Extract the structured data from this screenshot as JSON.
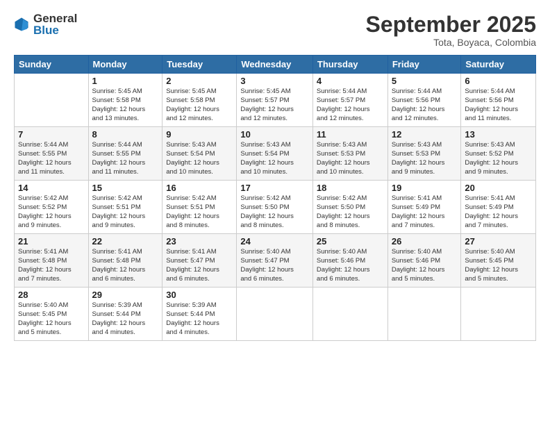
{
  "logo": {
    "general": "General",
    "blue": "Blue"
  },
  "header": {
    "month": "September 2025",
    "location": "Tota, Boyaca, Colombia"
  },
  "days": [
    "Sunday",
    "Monday",
    "Tuesday",
    "Wednesday",
    "Thursday",
    "Friday",
    "Saturday"
  ],
  "weeks": [
    [
      {
        "num": "",
        "text": ""
      },
      {
        "num": "1",
        "text": "Sunrise: 5:45 AM\nSunset: 5:58 PM\nDaylight: 12 hours\nand 13 minutes."
      },
      {
        "num": "2",
        "text": "Sunrise: 5:45 AM\nSunset: 5:58 PM\nDaylight: 12 hours\nand 12 minutes."
      },
      {
        "num": "3",
        "text": "Sunrise: 5:45 AM\nSunset: 5:57 PM\nDaylight: 12 hours\nand 12 minutes."
      },
      {
        "num": "4",
        "text": "Sunrise: 5:44 AM\nSunset: 5:57 PM\nDaylight: 12 hours\nand 12 minutes."
      },
      {
        "num": "5",
        "text": "Sunrise: 5:44 AM\nSunset: 5:56 PM\nDaylight: 12 hours\nand 12 minutes."
      },
      {
        "num": "6",
        "text": "Sunrise: 5:44 AM\nSunset: 5:56 PM\nDaylight: 12 hours\nand 11 minutes."
      }
    ],
    [
      {
        "num": "7",
        "text": "Sunrise: 5:44 AM\nSunset: 5:55 PM\nDaylight: 12 hours\nand 11 minutes."
      },
      {
        "num": "8",
        "text": "Sunrise: 5:44 AM\nSunset: 5:55 PM\nDaylight: 12 hours\nand 11 minutes."
      },
      {
        "num": "9",
        "text": "Sunrise: 5:43 AM\nSunset: 5:54 PM\nDaylight: 12 hours\nand 10 minutes."
      },
      {
        "num": "10",
        "text": "Sunrise: 5:43 AM\nSunset: 5:54 PM\nDaylight: 12 hours\nand 10 minutes."
      },
      {
        "num": "11",
        "text": "Sunrise: 5:43 AM\nSunset: 5:53 PM\nDaylight: 12 hours\nand 10 minutes."
      },
      {
        "num": "12",
        "text": "Sunrise: 5:43 AM\nSunset: 5:53 PM\nDaylight: 12 hours\nand 9 minutes."
      },
      {
        "num": "13",
        "text": "Sunrise: 5:43 AM\nSunset: 5:52 PM\nDaylight: 12 hours\nand 9 minutes."
      }
    ],
    [
      {
        "num": "14",
        "text": "Sunrise: 5:42 AM\nSunset: 5:52 PM\nDaylight: 12 hours\nand 9 minutes."
      },
      {
        "num": "15",
        "text": "Sunrise: 5:42 AM\nSunset: 5:51 PM\nDaylight: 12 hours\nand 9 minutes."
      },
      {
        "num": "16",
        "text": "Sunrise: 5:42 AM\nSunset: 5:51 PM\nDaylight: 12 hours\nand 8 minutes."
      },
      {
        "num": "17",
        "text": "Sunrise: 5:42 AM\nSunset: 5:50 PM\nDaylight: 12 hours\nand 8 minutes."
      },
      {
        "num": "18",
        "text": "Sunrise: 5:42 AM\nSunset: 5:50 PM\nDaylight: 12 hours\nand 8 minutes."
      },
      {
        "num": "19",
        "text": "Sunrise: 5:41 AM\nSunset: 5:49 PM\nDaylight: 12 hours\nand 7 minutes."
      },
      {
        "num": "20",
        "text": "Sunrise: 5:41 AM\nSunset: 5:49 PM\nDaylight: 12 hours\nand 7 minutes."
      }
    ],
    [
      {
        "num": "21",
        "text": "Sunrise: 5:41 AM\nSunset: 5:48 PM\nDaylight: 12 hours\nand 7 minutes."
      },
      {
        "num": "22",
        "text": "Sunrise: 5:41 AM\nSunset: 5:48 PM\nDaylight: 12 hours\nand 6 minutes."
      },
      {
        "num": "23",
        "text": "Sunrise: 5:41 AM\nSunset: 5:47 PM\nDaylight: 12 hours\nand 6 minutes."
      },
      {
        "num": "24",
        "text": "Sunrise: 5:40 AM\nSunset: 5:47 PM\nDaylight: 12 hours\nand 6 minutes."
      },
      {
        "num": "25",
        "text": "Sunrise: 5:40 AM\nSunset: 5:46 PM\nDaylight: 12 hours\nand 6 minutes."
      },
      {
        "num": "26",
        "text": "Sunrise: 5:40 AM\nSunset: 5:46 PM\nDaylight: 12 hours\nand 5 minutes."
      },
      {
        "num": "27",
        "text": "Sunrise: 5:40 AM\nSunset: 5:45 PM\nDaylight: 12 hours\nand 5 minutes."
      }
    ],
    [
      {
        "num": "28",
        "text": "Sunrise: 5:40 AM\nSunset: 5:45 PM\nDaylight: 12 hours\nand 5 minutes."
      },
      {
        "num": "29",
        "text": "Sunrise: 5:39 AM\nSunset: 5:44 PM\nDaylight: 12 hours\nand 4 minutes."
      },
      {
        "num": "30",
        "text": "Sunrise: 5:39 AM\nSunset: 5:44 PM\nDaylight: 12 hours\nand 4 minutes."
      },
      {
        "num": "",
        "text": ""
      },
      {
        "num": "",
        "text": ""
      },
      {
        "num": "",
        "text": ""
      },
      {
        "num": "",
        "text": ""
      }
    ]
  ]
}
